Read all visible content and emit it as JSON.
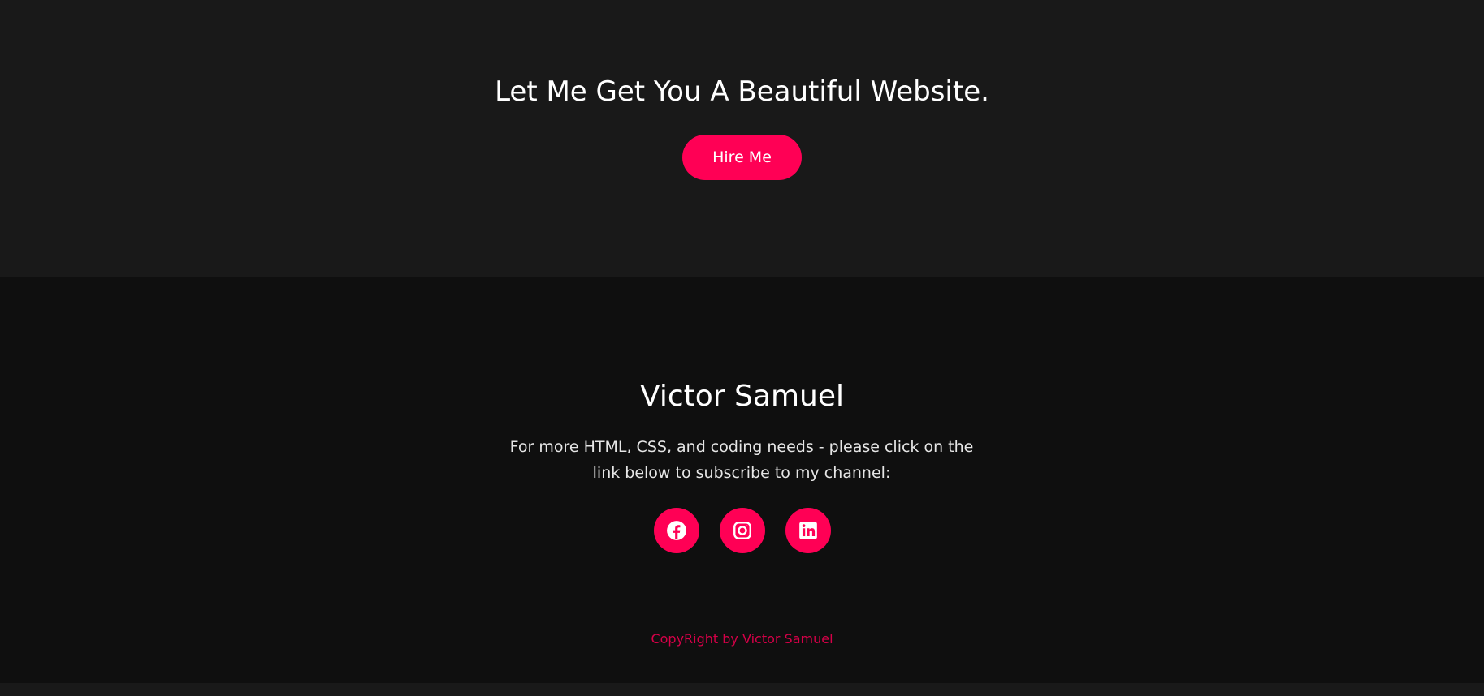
{
  "colors": {
    "accent": "#ff0055",
    "hero_bg": "#191919",
    "footer_bg": "#0f0f0f",
    "text_primary": "#ffffff",
    "text_secondary": "#e6e6e6",
    "copyright": "#d60048"
  },
  "hero": {
    "title": "Let Me Get You A Beautiful Website.",
    "button_label": "Hire Me"
  },
  "footer": {
    "name": "Victor Samuel",
    "text": "For more HTML, CSS, and coding needs - please click on the link below to subscribe to my channel:",
    "socials": [
      {
        "icon": "facebook-icon"
      },
      {
        "icon": "instagram-icon"
      },
      {
        "icon": "linkedin-icon"
      }
    ],
    "copyright": "CopyRight by Victor Samuel"
  }
}
